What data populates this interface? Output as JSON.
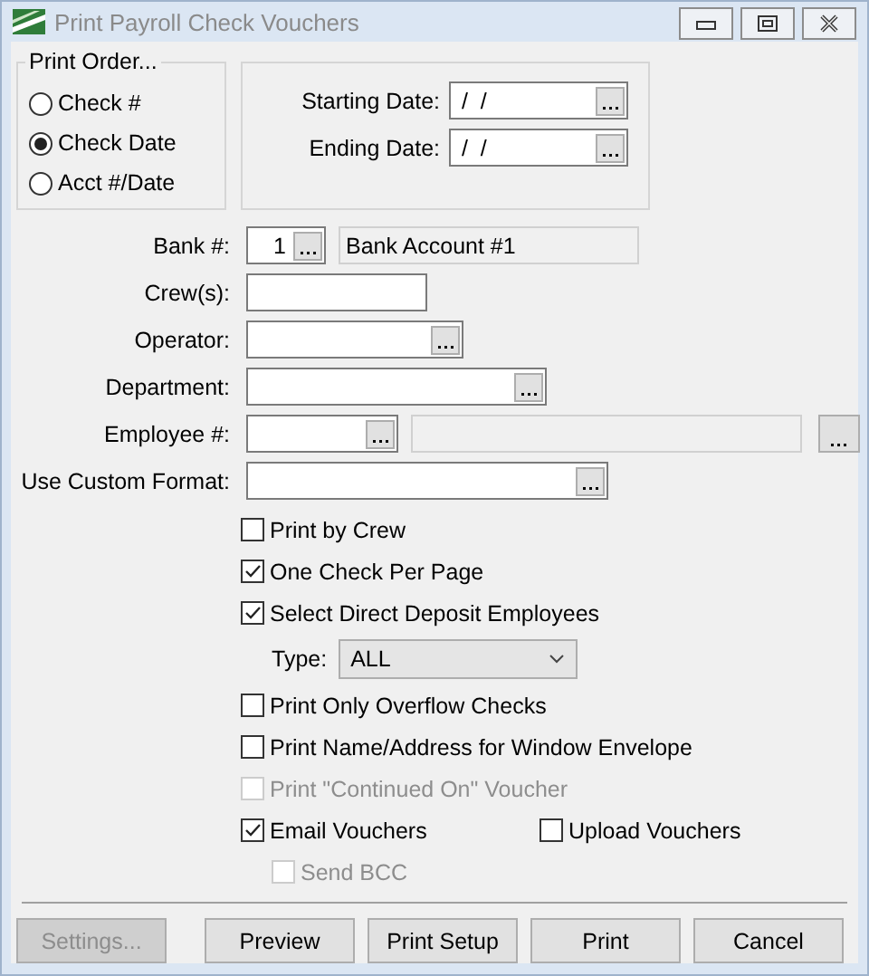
{
  "window": {
    "title": "Print Payroll Check Vouchers"
  },
  "print_order": {
    "label": "Print Order...",
    "options": [
      {
        "label": "Check #",
        "selected": false
      },
      {
        "label": "Check Date",
        "selected": true
      },
      {
        "label": "Acct #/Date",
        "selected": false
      }
    ]
  },
  "dates": [
    {
      "label": "Starting Date:",
      "value": "/  /"
    },
    {
      "label": "Ending Date:",
      "value": "/  /"
    }
  ],
  "bank": {
    "label": "Bank #:",
    "value": "1",
    "account": "Bank Account #1"
  },
  "fields": [
    {
      "label": "Crew(s):",
      "kind": "text"
    },
    {
      "label": "Operator:",
      "kind": "lookup"
    },
    {
      "label": "Department:",
      "kind": "lookup"
    },
    {
      "label": "Employee #:",
      "kind": "employee"
    },
    {
      "label": "Use Custom Format:",
      "kind": "lookup"
    }
  ],
  "options": [
    {
      "kind": "checkbox",
      "label": "Print by Crew",
      "checked": false,
      "disabled": false
    },
    {
      "kind": "checkbox",
      "label": "One Check Per Page",
      "checked": true,
      "disabled": false
    },
    {
      "kind": "checkbox",
      "label": "Select Direct Deposit Employees",
      "checked": true,
      "disabled": false,
      "children": [
        {
          "kind": "select",
          "label": "Type:",
          "value": "ALL"
        }
      ]
    },
    {
      "kind": "checkbox",
      "label": "Print Only Overflow Checks",
      "checked": false,
      "disabled": false
    },
    {
      "kind": "checkbox",
      "label": "Print Name/Address for Window Envelope",
      "checked": false,
      "disabled": false
    },
    {
      "kind": "checkbox",
      "label": "Print \"Continued On\" Voucher",
      "checked": false,
      "disabled": true
    },
    {
      "kind": "pair",
      "items": [
        {
          "label": "Email Vouchers",
          "checked": true,
          "disabled": false
        },
        {
          "label": "Upload Vouchers",
          "checked": false,
          "disabled": false
        }
      ],
      "children": [
        {
          "kind": "checkbox",
          "label": "Send BCC",
          "checked": false,
          "disabled": true
        }
      ]
    }
  ],
  "buttons": [
    {
      "label": "Settings...",
      "disabled": true
    },
    {
      "label": "Preview",
      "disabled": false
    },
    {
      "label": "Print Setup",
      "disabled": false
    },
    {
      "label": "Print",
      "disabled": false
    },
    {
      "label": "Cancel",
      "disabled": false
    }
  ]
}
